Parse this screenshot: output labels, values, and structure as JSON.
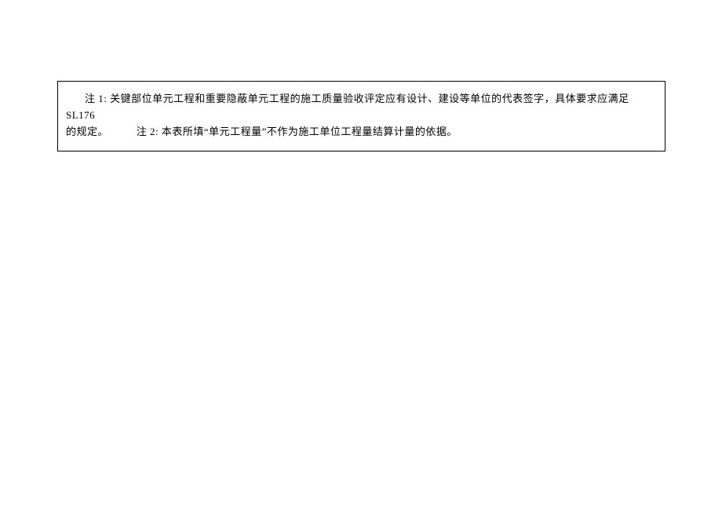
{
  "notes": {
    "note1": {
      "label": "注 1:",
      "text_part1": "关键部位单元工程和重要隐蔽单元工程的施工质量验收评定应有设计、建设等单位的代表签字，具体要求应满足 SL176",
      "text_part2": "的规定。"
    },
    "note2": {
      "label": "注 2:",
      "text": "本表所填“单元工程量”不作为施工单位工程量结算计量的依据。"
    }
  }
}
